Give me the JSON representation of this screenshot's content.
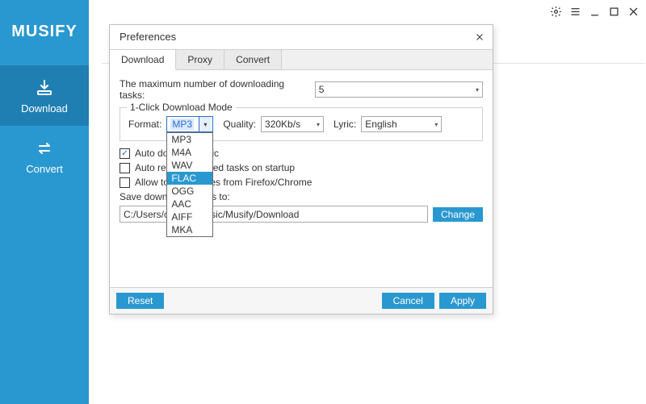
{
  "app": {
    "logo": "MUSIFY"
  },
  "sidebar": {
    "items": [
      {
        "label": "Download"
      },
      {
        "label": "Convert"
      }
    ]
  },
  "dialog": {
    "title": "Preferences",
    "tabs": [
      {
        "label": "Download"
      },
      {
        "label": "Proxy"
      },
      {
        "label": "Convert"
      }
    ],
    "max_tasks_label": "The maximum number of downloading tasks:",
    "max_tasks_value": "5",
    "oneclick_legend": "1-Click Download Mode",
    "format_label": "Format:",
    "format_value": "MP3",
    "format_options": [
      "MP3",
      "M4A",
      "WAV",
      "FLAC",
      "OGG",
      "AAC",
      "AIFF",
      "MKA"
    ],
    "format_highlight_index": 3,
    "quality_label": "Quality:",
    "quality_value": "320Kb/s",
    "lyric_label": "Lyric:",
    "lyric_value": "English",
    "chk_auto_lyric": "Auto download lyric",
    "chk_auto_retry": "Auto retry unfinished tasks on startup",
    "chk_allow_cookies": "Allow to get cookies from Firefox/Chrome",
    "chk_auto_lyric_checked": true,
    "chk_auto_retry_checked": false,
    "chk_allow_cookies_checked": false,
    "save_label": "Save downloaded files to:",
    "save_path": "C:/Users/claudia/Music/Musify/Download",
    "btn_change": "Change",
    "btn_reset": "Reset",
    "btn_cancel": "Cancel",
    "btn_apply": "Apply"
  }
}
